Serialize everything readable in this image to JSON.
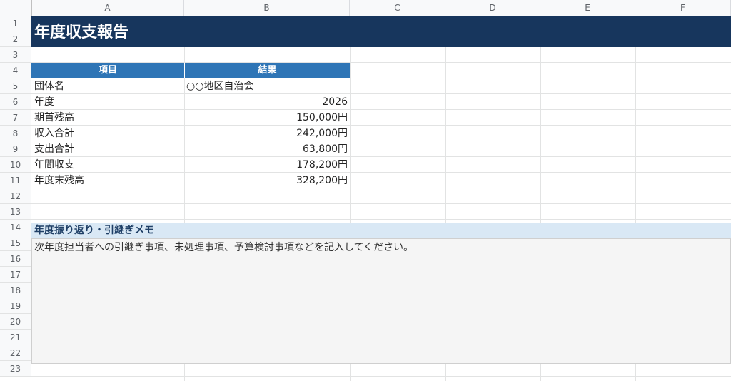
{
  "columns": [
    "A",
    "B",
    "C",
    "D",
    "E",
    "F"
  ],
  "rows": [
    "1",
    "2",
    "3",
    "4",
    "5",
    "6",
    "7",
    "8",
    "9",
    "10",
    "11",
    "12",
    "13",
    "14",
    "15",
    "16",
    "17",
    "18",
    "19",
    "20",
    "21",
    "22",
    "23"
  ],
  "title": "年度収支報告",
  "table": {
    "header_item": "項目",
    "header_result": "結果",
    "rows": [
      {
        "item": "団体名",
        "value": "○○地区自治会"
      },
      {
        "item": "年度",
        "value": "2026"
      },
      {
        "item": "期首残高",
        "value": "150,000円"
      },
      {
        "item": "収入合計",
        "value": "242,000円"
      },
      {
        "item": "支出合計",
        "value": "63,800円"
      },
      {
        "item": "年間収支",
        "value": "178,200円"
      },
      {
        "item": "年度末残高",
        "value": "328,200円"
      }
    ]
  },
  "memo": {
    "title": "年度振り返り・引継ぎメモ",
    "text": "次年度担当者への引継ぎ事項、未処理事項、予算検討事項などを記入してください。"
  },
  "colors": {
    "title_bg": "#17365d",
    "table_header_bg": "#2e75b6",
    "memo_header_bg": "#d9e8f5",
    "memo_box_bg": "#f5f5f5"
  }
}
